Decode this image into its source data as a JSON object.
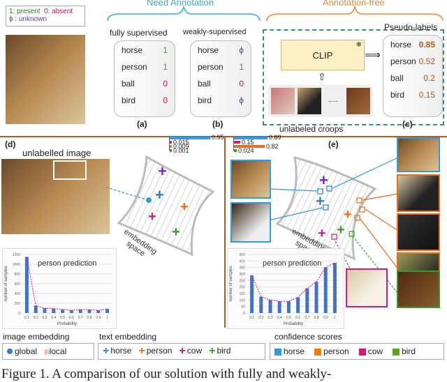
{
  "legend_top": {
    "present": "1: present",
    "absent": "0: absent",
    "unknown": "ϕ : unknown"
  },
  "need_annotation": "Need Annotation",
  "annotation_free": "Annotation-free",
  "panel_a": {
    "title": "fully supervised",
    "label": "(a)",
    "rows": [
      {
        "name": "horse",
        "value": "1"
      },
      {
        "name": "person",
        "value": "1"
      },
      {
        "name": "ball",
        "value": "0"
      },
      {
        "name": "bird",
        "value": "0"
      }
    ]
  },
  "panel_b": {
    "title": "weakly-supervised",
    "label": "(b)",
    "rows": [
      {
        "name": "horse",
        "value": "ϕ"
      },
      {
        "name": "person",
        "value": "1"
      },
      {
        "name": "ball",
        "value": "0"
      },
      {
        "name": "bird",
        "value": "ϕ"
      }
    ]
  },
  "panel_c": {
    "clip": "CLIP",
    "pseudo_title": "Pseudo-labels",
    "crops_label": "unlabeled croops",
    "dots": ".....",
    "label": "(c)",
    "rows": [
      {
        "name": "horse",
        "value": "0.85"
      },
      {
        "name": "person",
        "value": "0.52"
      },
      {
        "name": "ball",
        "value": "0.2"
      },
      {
        "name": "bird",
        "value": "0.15"
      }
    ]
  },
  "panel_d": {
    "label": "(d)",
    "image_title": "unlabelled image",
    "embedding_label": "embedding space",
    "scores": [
      {
        "value": "0.95",
        "color": "#2f9be0"
      },
      {
        "value": "0.015",
        "color": "#d81b7a"
      },
      {
        "value": "0.009",
        "color": "#f26b1d"
      },
      {
        "value": "0.001",
        "color": "#3a9a2a"
      }
    ]
  },
  "panel_e": {
    "label": "(e)",
    "embedding_label": "embedding space",
    "scores": [
      {
        "value": "0.89",
        "color": "#2f9be0"
      },
      {
        "value": "0.15",
        "color": "#d81b7a"
      },
      {
        "value": "0.82",
        "color": "#f26b1d"
      },
      {
        "value": "0.024",
        "color": "#3a9a2a"
      }
    ]
  },
  "chart_data": [
    {
      "type": "bar",
      "title": "person prediction",
      "xlabel": "Probability",
      "ylabel": "number of samples",
      "categories": [
        "0.1",
        "0.2",
        "0.3",
        "0.4",
        "0.5",
        "0.6",
        "0.7",
        "0.8",
        "0.9",
        "1"
      ],
      "values": [
        1150,
        150,
        100,
        90,
        70,
        55,
        70,
        70,
        55,
        85
      ],
      "ylim": [
        0,
        1200
      ],
      "yticks": [
        "0",
        "200",
        "400",
        "600",
        "800",
        "1000",
        "1200"
      ],
      "trendline": true,
      "grid": true
    },
    {
      "type": "bar",
      "title": "person prediction",
      "xlabel": "Probability",
      "ylabel": "number of samples",
      "categories": [
        "0.1",
        "0.2",
        "0.3",
        "0.4",
        "0.5",
        "0.6",
        "0.7",
        "0.8",
        "0.9",
        "1"
      ],
      "values": [
        290,
        125,
        100,
        90,
        90,
        120,
        190,
        240,
        350,
        385
      ],
      "ylim": [
        0,
        450
      ],
      "yticks": [
        "0",
        "50",
        "100",
        "150",
        "200",
        "250",
        "300",
        "350",
        "400",
        "450"
      ],
      "trendline": true,
      "grid": true
    }
  ],
  "legend_bottom": {
    "image_title": "image embedding",
    "global": "global",
    "local": "local",
    "text_title": "text embedding",
    "text_items": [
      {
        "name": "horse",
        "color": "#2f7fc8"
      },
      {
        "name": "person",
        "color": "#f26b1d"
      },
      {
        "name": "cow",
        "color": "#c2185b"
      },
      {
        "name": "bird",
        "color": "#3a9a2a"
      }
    ],
    "conf_title": "confidence scores",
    "conf_items": [
      {
        "name": "horse",
        "color": "#2f9be0"
      },
      {
        "name": "person",
        "color": "#f57c00"
      },
      {
        "name": "cow",
        "color": "#e0157a"
      },
      {
        "name": "bird",
        "color": "#5aa820"
      }
    ]
  },
  "caption": "Figure 1. A comparison of our solution with fully and weakly-"
}
